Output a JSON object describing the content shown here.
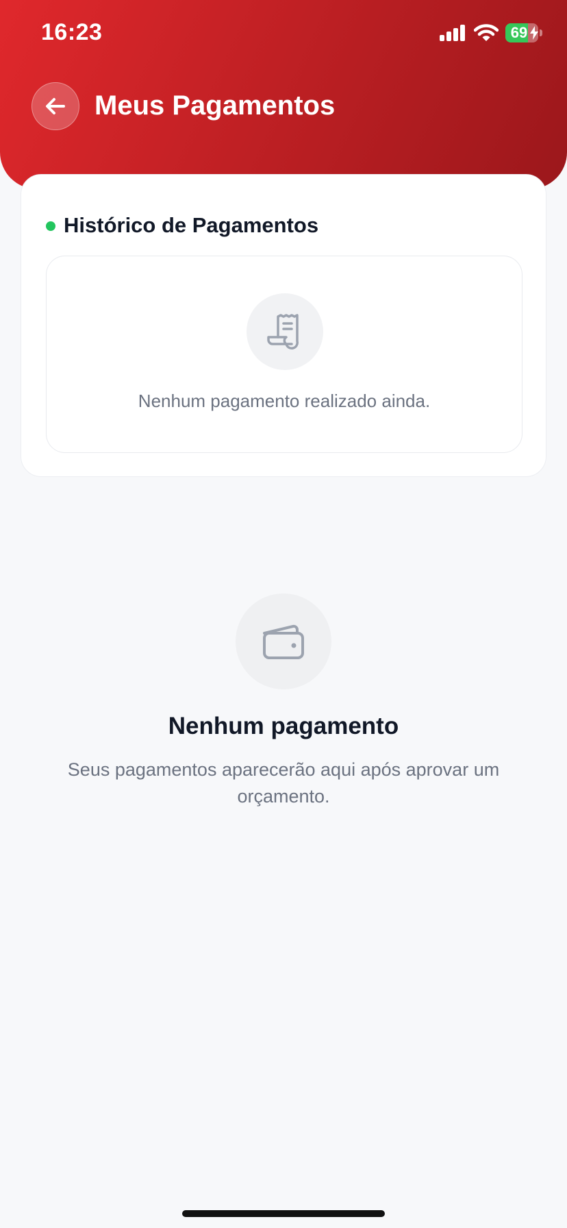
{
  "status_bar": {
    "time": "16:23",
    "battery_level": "69",
    "battery_fraction": 0.69,
    "icons": [
      "cellular-signal-icon",
      "wifi-icon",
      "battery-charging-icon"
    ]
  },
  "header": {
    "title": "Meus Pagamentos",
    "back_icon": "arrow-left-icon",
    "gradient_colors": [
      "#e0282c",
      "#9b171b"
    ]
  },
  "history": {
    "title": "Histórico de Pagamentos",
    "indicator_color": "#22c55e",
    "empty_icon": "receipt-icon",
    "empty_text": "Nenhum pagamento realizado ainda."
  },
  "empty_state": {
    "icon": "wallet-icon",
    "title": "Nenhum pagamento",
    "subtitle": "Seus pagamentos aparecerão aqui após aprovar um orçamento."
  }
}
